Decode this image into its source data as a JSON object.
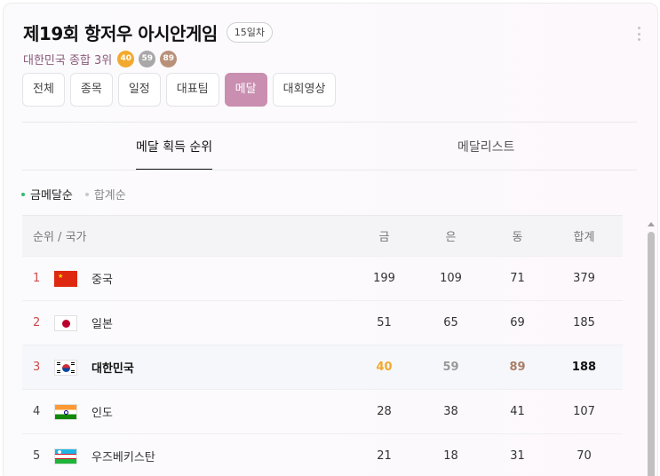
{
  "header": {
    "title": "제19회 항저우 아시안게임",
    "day_badge": "15일차",
    "rank_text": "대한민국 종합 3위",
    "medals": {
      "gold": "40",
      "silver": "59",
      "bronze": "89"
    }
  },
  "colors": {
    "accent": "#c98eb0",
    "gold": "#f2a92d",
    "silver": "#a8a8a8",
    "bronze": "#b9917a",
    "rank_red": "#d14b4b",
    "sort_dot": "#2fbf71"
  },
  "tabs": [
    {
      "label": "전체"
    },
    {
      "label": "종목"
    },
    {
      "label": "일정"
    },
    {
      "label": "대표팀"
    },
    {
      "label": "메달",
      "active": true
    },
    {
      "label": "대회영상"
    }
  ],
  "subtabs": {
    "rank": "메달 획득 순위",
    "list": "메달리스트"
  },
  "sort": {
    "gold_order": "금메달순",
    "total_order": "합계순"
  },
  "table": {
    "header": {
      "rank_country": "순위 / 국가",
      "gold": "금",
      "silver": "은",
      "bronze": "동",
      "total": "합계"
    },
    "rows": [
      {
        "rank": "1",
        "flag": "china-flag",
        "country": "중국",
        "gold": "199",
        "silver": "109",
        "bronze": "71",
        "total": "379"
      },
      {
        "rank": "2",
        "flag": "japan-flag",
        "country": "일본",
        "gold": "51",
        "silver": "65",
        "bronze": "69",
        "total": "185"
      },
      {
        "rank": "3",
        "flag": "korea-flag",
        "country": "대한민국",
        "gold": "40",
        "silver": "59",
        "bronze": "89",
        "total": "188"
      },
      {
        "rank": "4",
        "flag": "india-flag",
        "country": "인도",
        "gold": "28",
        "silver": "38",
        "bronze": "41",
        "total": "107"
      },
      {
        "rank": "5",
        "flag": "uzbekistan-flag",
        "country": "우즈베키스탄",
        "gold": "21",
        "silver": "18",
        "bronze": "31",
        "total": "70"
      }
    ]
  }
}
